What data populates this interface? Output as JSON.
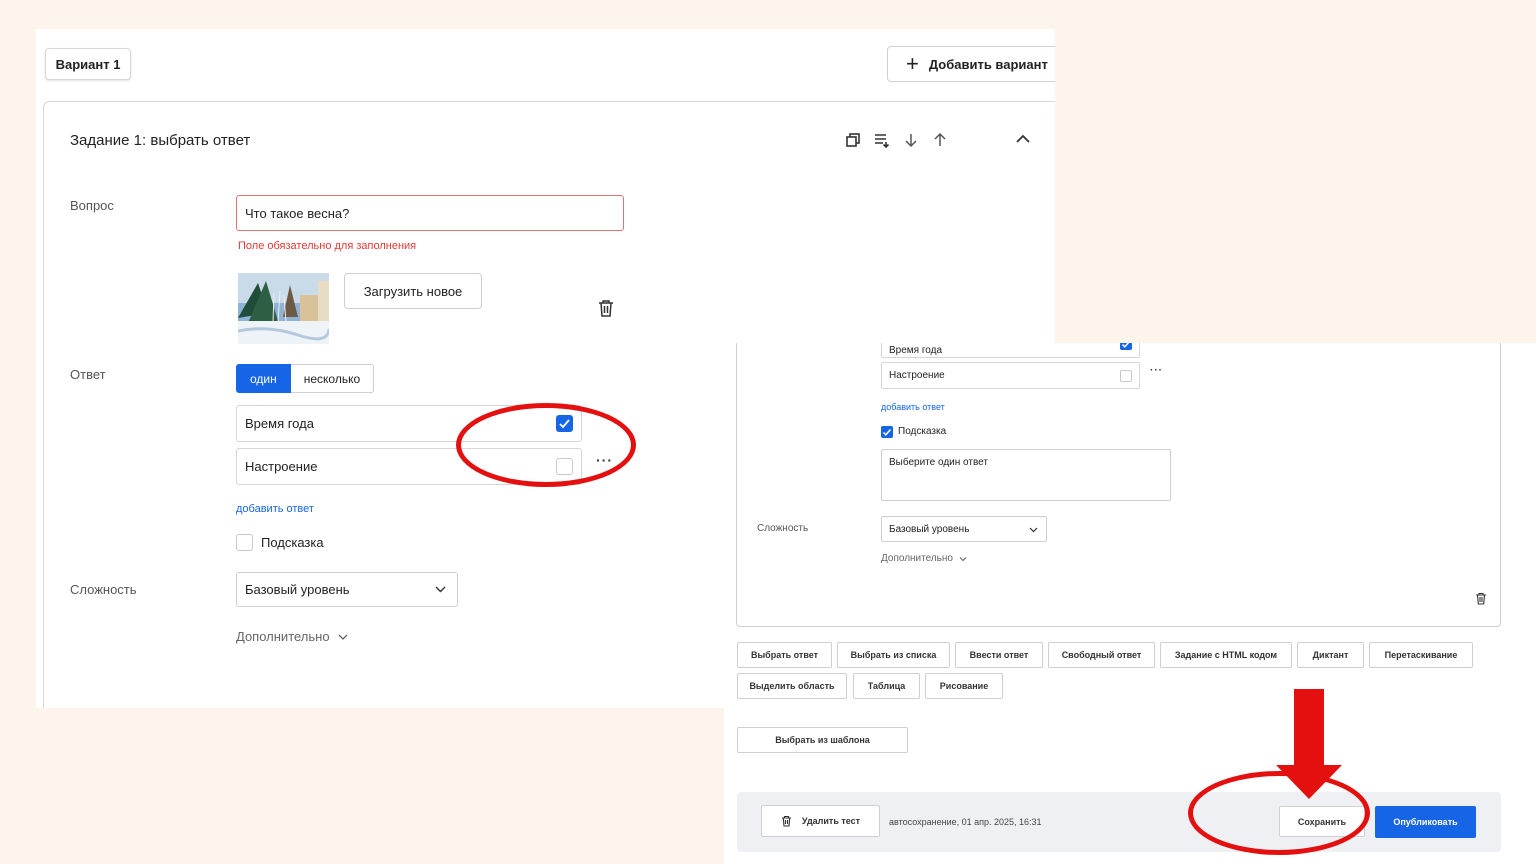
{
  "left": {
    "variant_tab": "Вариант 1",
    "add_variant": "Добавить вариант",
    "task_title": "Задание 1: выбрать ответ",
    "question_label": "Вопрос",
    "question_value": "Что такое весна?",
    "error_text": "Поле обязательно для заполнения",
    "upload_button": "Загрузить новое",
    "answer_label": "Ответ",
    "mode_single": "один",
    "mode_multi": "несколько",
    "answers": [
      {
        "text": "Время года",
        "checked": true
      },
      {
        "text": "Настроение",
        "checked": false
      }
    ],
    "more": "···",
    "add_answer": "добавить ответ",
    "hint_label": "Подсказка",
    "difficulty_label": "Сложность",
    "difficulty_value": "Базовый уровень",
    "extra": "Дополнительно"
  },
  "right": {
    "answers": [
      {
        "text": "Время года",
        "checked": true
      },
      {
        "text": "Настроение",
        "checked": false
      }
    ],
    "more": "···",
    "add_answer": "добавить ответ",
    "hint_label": "Подсказка",
    "hint_text": "Выберите один ответ",
    "difficulty_label": "Сложность",
    "difficulty_value": "Базовый уровень",
    "extra": "Дополнительно",
    "task_types_row1": [
      "Выбрать ответ",
      "Выбрать из списка",
      "Ввести ответ",
      "Свободный ответ",
      "Задание с HTML кодом",
      "Диктант",
      "Перетаскивание"
    ],
    "task_types_row2": [
      "Выделить область",
      "Таблица",
      "Рисование"
    ],
    "template_button": "Выбрать из шаблона",
    "delete_test": "Удалить тест",
    "autosave": "автосохранение, 01 апр. 2025, 16:31",
    "save": "Сохранить",
    "publish": "Опубликовать"
  },
  "colors": {
    "accent": "#1565e6",
    "error": "#e53935",
    "annotation": "#e3100f",
    "background": "#fdf4ec"
  },
  "icons": [
    "plus-icon",
    "copy-icon",
    "list-icon",
    "arrow-down-icon",
    "arrow-up-icon",
    "chevron-up-icon",
    "trash-icon",
    "check-icon",
    "chevron-down-icon"
  ]
}
